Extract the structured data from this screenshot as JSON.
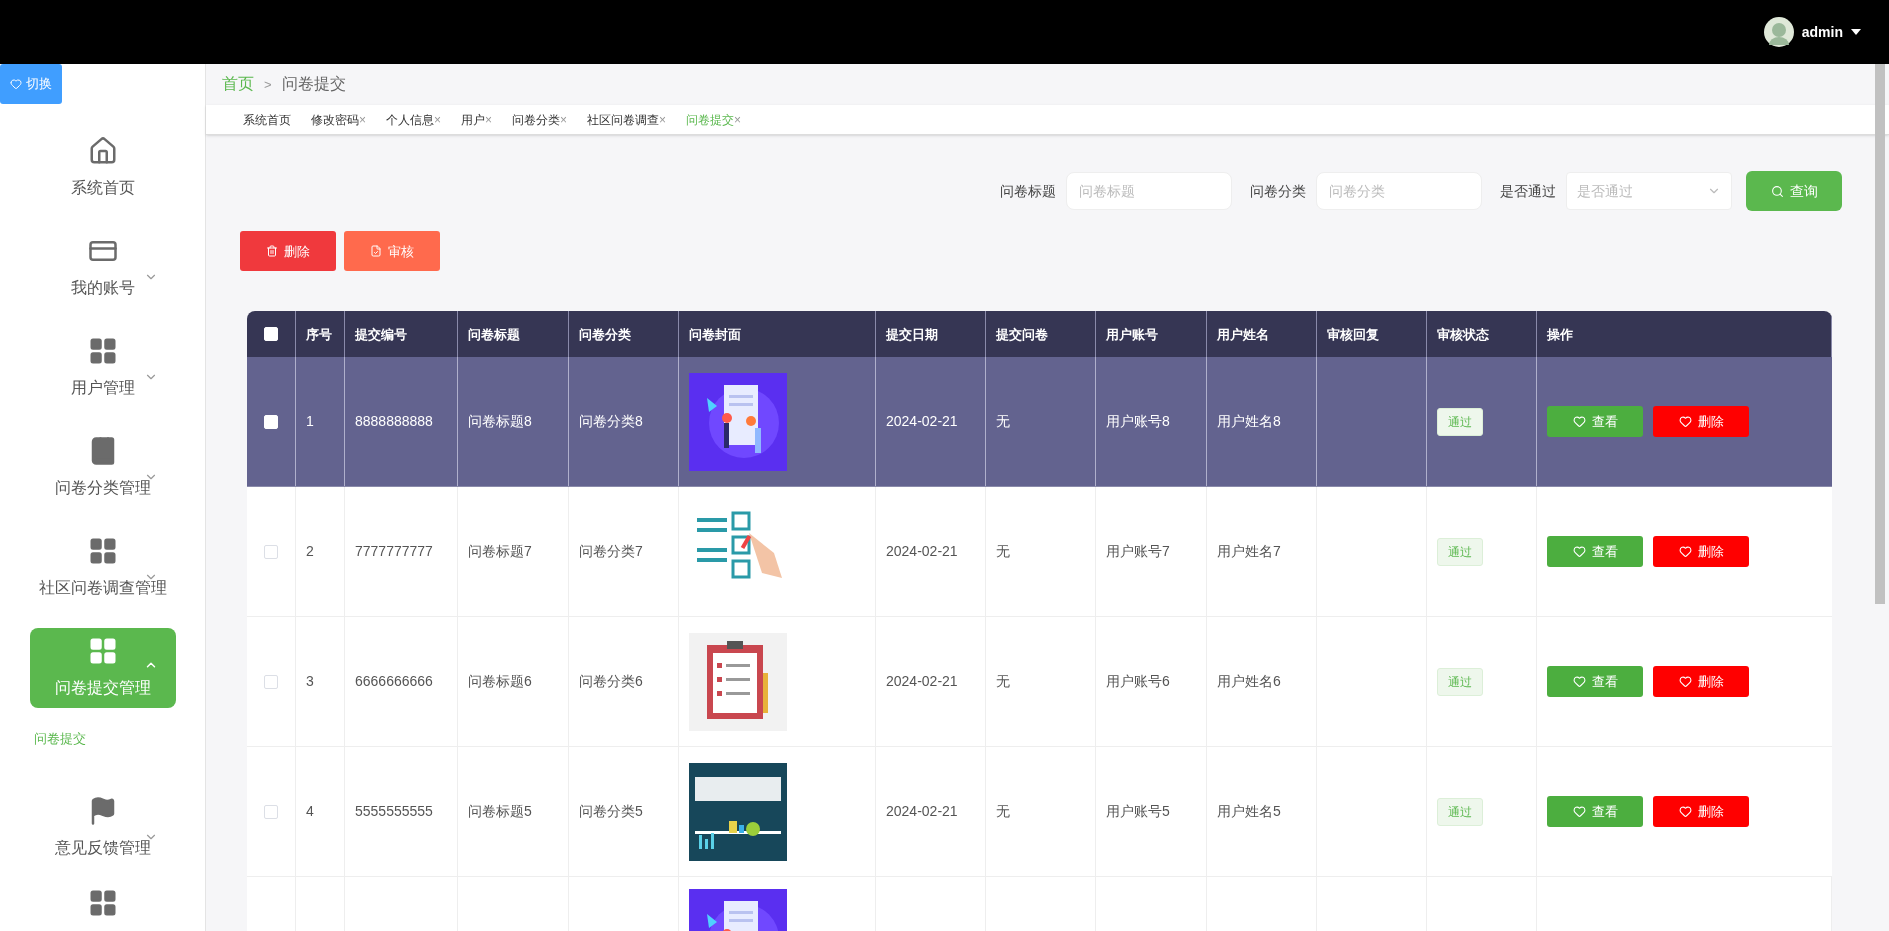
{
  "header": {
    "user": "admin"
  },
  "switch_button": "切换",
  "sidebar": {
    "items": [
      {
        "label": "系统首页",
        "selected": false
      },
      {
        "label": "我的账号",
        "expanded": false,
        "selected": false
      },
      {
        "label": "用户管理",
        "expanded": false,
        "selected": false
      },
      {
        "label": "问卷分类管理",
        "expanded": false,
        "selected": false
      },
      {
        "label": "社区问卷调查管理",
        "expanded": false,
        "selected": false
      },
      {
        "label": "问卷提交管理",
        "expanded": true,
        "selected": true,
        "children": [
          {
            "label": "问卷提交",
            "selected": true
          }
        ]
      },
      {
        "label": "意见反馈管理",
        "expanded": false,
        "selected": false
      }
    ]
  },
  "breadcrumb": [
    "首页",
    "问卷提交"
  ],
  "breadcrumb_separator": ">",
  "tabs": [
    {
      "label": "系统首页",
      "closable": false,
      "selected": false
    },
    {
      "label": "修改密码",
      "closable": true,
      "selected": false
    },
    {
      "label": "个人信息",
      "closable": true,
      "selected": false
    },
    {
      "label": "用户",
      "closable": true,
      "selected": false
    },
    {
      "label": "问卷分类",
      "closable": true,
      "selected": false
    },
    {
      "label": "社区问卷调查",
      "closable": true,
      "selected": false
    },
    {
      "label": "问卷提交",
      "closable": true,
      "selected": true
    }
  ],
  "tab_close": "×",
  "search": {
    "fields": [
      {
        "label": "问卷标题",
        "placeholder": "问卷标题",
        "kind": "input"
      },
      {
        "label": "问卷分类",
        "placeholder": "问卷分类",
        "kind": "input"
      },
      {
        "label": "是否通过",
        "placeholder": "是否通过",
        "kind": "select"
      }
    ],
    "button": "查询"
  },
  "actions": [
    "删除",
    "审核"
  ],
  "table": {
    "columns": [
      "序号",
      "提交编号",
      "问卷标题",
      "问卷分类",
      "问卷封面",
      "提交日期",
      "提交问卷",
      "用户账号",
      "用户姓名",
      "审核回复",
      "审核状态",
      "操作"
    ],
    "header_checked": false,
    "rows": [
      {
        "kind": "full",
        "highlighted": true,
        "checked": false,
        "index": "1",
        "number": "8888888888",
        "title": "问卷标题8",
        "category": "问卷分类8",
        "date": "2024-02-21",
        "submitted": "无",
        "account": "用户账号8",
        "name": "用户姓名8",
        "status": "通过",
        "view": "查看",
        "delete": "删除"
      },
      {
        "kind": "full",
        "highlighted": false,
        "checked": false,
        "index": "2",
        "number": "7777777777",
        "title": "问卷标题7",
        "category": "问卷分类7",
        "date": "2024-02-21",
        "submitted": "无",
        "account": "用户账号7",
        "name": "用户姓名7",
        "status": "通过",
        "view": "查看",
        "delete": "删除"
      },
      {
        "kind": "full",
        "highlighted": false,
        "checked": false,
        "index": "3",
        "number": "6666666666",
        "title": "问卷标题6",
        "category": "问卷分类6",
        "date": "2024-02-21",
        "submitted": "无",
        "account": "用户账号6",
        "name": "用户姓名6",
        "status": "通过",
        "view": "查看",
        "delete": "删除"
      },
      {
        "kind": "full",
        "highlighted": false,
        "checked": false,
        "index": "4",
        "number": "5555555555",
        "title": "问卷标题5",
        "category": "问卷分类5",
        "date": "2024-02-21",
        "submitted": "无",
        "account": "用户账号5",
        "name": "用户姓名5",
        "status": "通过",
        "view": "查看",
        "delete": "删除"
      },
      {
        "kind": "partial"
      }
    ]
  }
}
